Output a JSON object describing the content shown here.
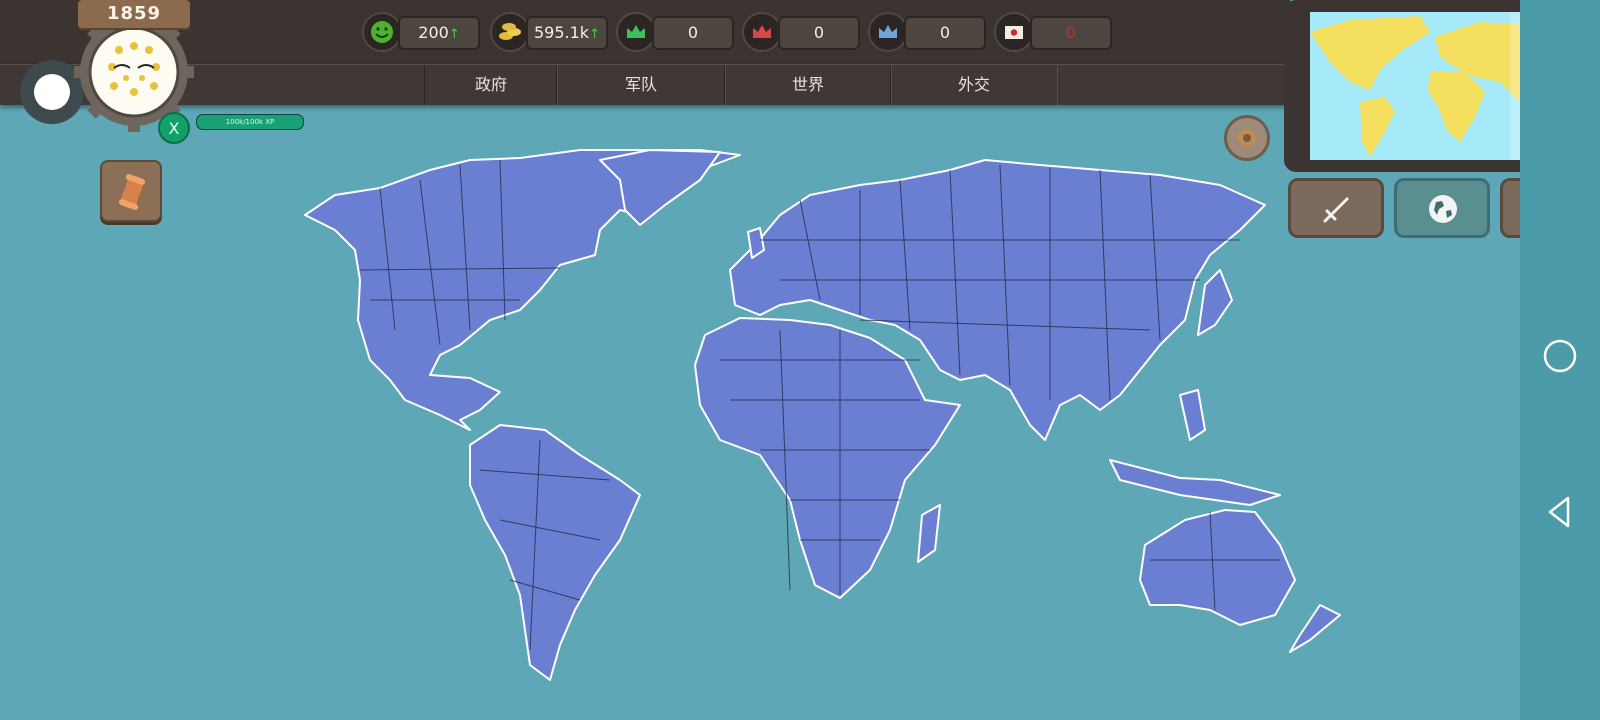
{
  "year": "1859",
  "resources": [
    {
      "name": "happiness",
      "icon": "smiley-icon",
      "value": "200",
      "trend": "up",
      "color": "#4fb22f"
    },
    {
      "name": "gold",
      "icon": "gold-coins-icon",
      "value": "595.1k",
      "trend": "up",
      "color": "#e2b93c"
    },
    {
      "name": "green-crown",
      "icon": "green-crown-icon",
      "value": "0",
      "trend": "",
      "color": "#3fbf5b"
    },
    {
      "name": "red-crown",
      "icon": "red-crown-icon",
      "value": "0",
      "trend": "",
      "color": "#d84848"
    },
    {
      "name": "blue-crown",
      "icon": "blue-crown-icon",
      "value": "0",
      "trend": "",
      "color": "#6fa6d8"
    },
    {
      "name": "diplomacy",
      "icon": "envelope-icon",
      "value": "0",
      "trend": "",
      "color": "#cc2b2b"
    }
  ],
  "tabs": [
    "政府",
    "军队",
    "世界",
    "外交"
  ],
  "player": {
    "badge": "X",
    "xp_text": "100k/100k XP",
    "xp_fraction": 1.0
  },
  "colors": {
    "ocean": "#5ea7b6",
    "land": "#6a7fd1",
    "border": "#1a1d35",
    "minimap_land": "#f5df5e",
    "minimap_sea": "#a6eaf9"
  }
}
